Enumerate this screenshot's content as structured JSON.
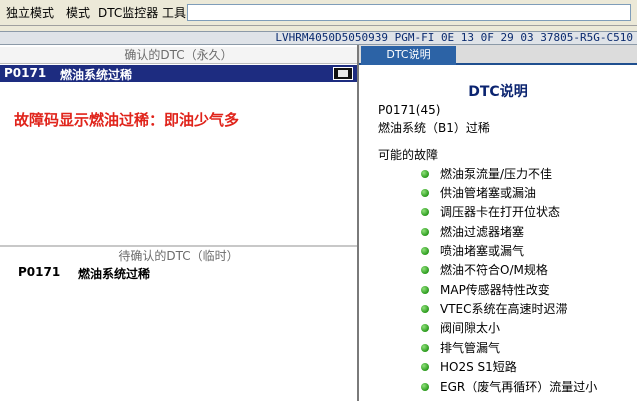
{
  "menubar": {
    "items": [
      "独立模式",
      "模式",
      "DTC监控器",
      "工具"
    ]
  },
  "vehicle_info": "LVHRM4050D5050939  PGM-FI  0E 13 0F 29 03  37805-R5G-C510",
  "confirmed": {
    "title": "确认的DTC（永久）",
    "code": "P0171",
    "description": "燃油系统过稀"
  },
  "annotation": "故障码显示燃油过稀：即油少气多",
  "pending": {
    "title": "待确认的DTC（临时）",
    "code": "P0171",
    "description": "燃油系统过稀"
  },
  "dtc_panel": {
    "tab_label": "DTC说明",
    "heading": "DTC说明",
    "code_line": "P0171(45)",
    "name_line": "燃油系统（B1）过稀",
    "causes_label": "可能的故障",
    "causes": [
      "燃油泵流量/压力不佳",
      "供油管堵塞或漏油",
      "调压器卡在打开位状态",
      "燃油过滤器堵塞",
      "喷油堵塞或漏气",
      "燃油不符合O/M规格",
      "MAP传感器特性改变",
      "VTEC系统在高速时迟滞",
      "阀间隙太小",
      "排气管漏气",
      "HO2S S1短路",
      "EGR（废气再循环）流量过小"
    ]
  }
}
